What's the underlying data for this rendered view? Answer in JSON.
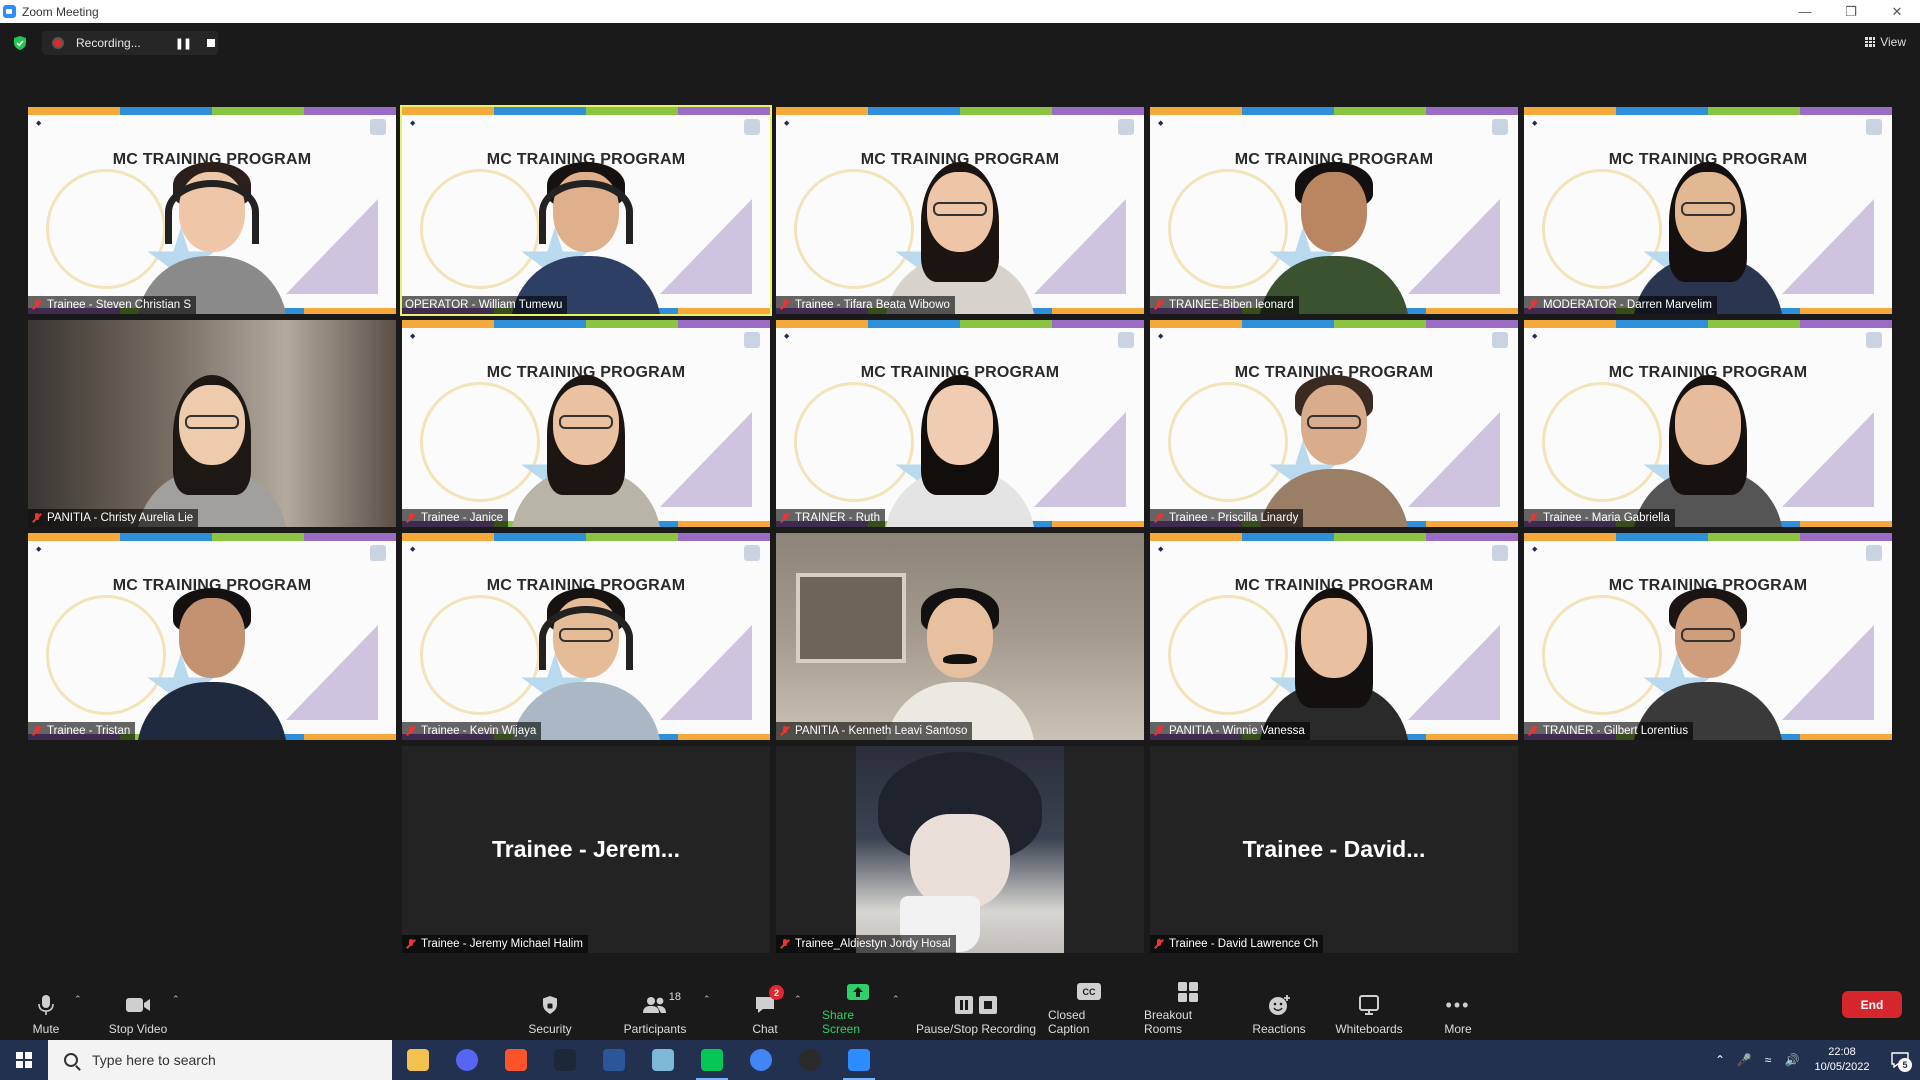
{
  "window": {
    "title": "Zoom Meeting",
    "controls": [
      "minimize",
      "restore",
      "close"
    ]
  },
  "top_bar": {
    "recording_label": "Recording...",
    "view_label": "View",
    "security_icon": "shield-check-icon"
  },
  "banner_text": "MC TRAINING PROGRAM",
  "banner_colors": [
    "#f4a93a",
    "#2f8fd8",
    "#8bc441",
    "#9b6cc6"
  ],
  "participants": [
    {
      "name": "Trainee - Steven Christian S",
      "bg": "banner",
      "muted": true
    },
    {
      "name": "OPERATOR - William Tumewu",
      "bg": "banner",
      "muted": false,
      "active_speaker": true
    },
    {
      "name": "Trainee - Tifara Beata Wibowo",
      "bg": "banner",
      "muted": true
    },
    {
      "name": "TRAINEE-Biben leonard",
      "bg": "banner",
      "muted": true
    },
    {
      "name": "MODERATOR - Darren Marvelim",
      "bg": "banner",
      "muted": true
    },
    {
      "name": "PANITIA - Christy Aurelia Lie",
      "bg": "room",
      "muted": true
    },
    {
      "name": "Trainee - Janice",
      "bg": "banner",
      "muted": true
    },
    {
      "name": "TRAINER - Ruth",
      "bg": "banner",
      "muted": true
    },
    {
      "name": "Trainee - Priscilla Linardy",
      "bg": "banner",
      "muted": true
    },
    {
      "name": "Trainee - Maria Gabriella",
      "bg": "banner",
      "muted": true
    },
    {
      "name": "Trainee - Tristan",
      "bg": "banner",
      "muted": true
    },
    {
      "name": "Trainee - Kevin Wijaya",
      "bg": "banner",
      "muted": true
    },
    {
      "name": "PANITIA - Kenneth Leavi Santoso",
      "bg": "shelf",
      "muted": true
    },
    {
      "name": "PANITIA - Winnie Vanessa",
      "bg": "banner",
      "muted": true
    },
    {
      "name": "TRAINER - Gilbert Lorentius",
      "bg": "banner",
      "muted": true
    },
    {
      "name": "Trainee - Jeremy Michael Halim",
      "bg": "videooff",
      "display": "Trainee - Jerem...",
      "muted": true
    },
    {
      "name": "Trainee_Aldiestyn Jordy Hosal",
      "bg": "avatar",
      "muted": true
    },
    {
      "name": "Trainee - David Lawrence Ch",
      "bg": "videooff",
      "display": "Trainee - David...",
      "muted": true
    }
  ],
  "toolbar": {
    "mute": "Mute",
    "stop_video": "Stop Video",
    "security": "Security",
    "participants": "Participants",
    "participants_count": "18",
    "chat": "Chat",
    "chat_badge": "2",
    "share_screen": "Share Screen",
    "pause_stop_recording": "Pause/Stop Recording",
    "closed_caption": "Closed Caption",
    "closed_caption_icon_text": "CC",
    "breakout_rooms": "Breakout Rooms",
    "reactions": "Reactions",
    "whiteboards": "Whiteboards",
    "more": "More",
    "end": "End"
  },
  "taskbar": {
    "search_placeholder": "Type here to search",
    "time": "22:08",
    "date": "10/05/2022",
    "notification_count": "5",
    "apps": [
      "file-explorer-icon",
      "discord-icon",
      "brave-icon",
      "steam-icon",
      "word-icon",
      "notepad-icon",
      "line-icon",
      "chrome-icon",
      "obs-icon",
      "zoom-icon"
    ]
  }
}
